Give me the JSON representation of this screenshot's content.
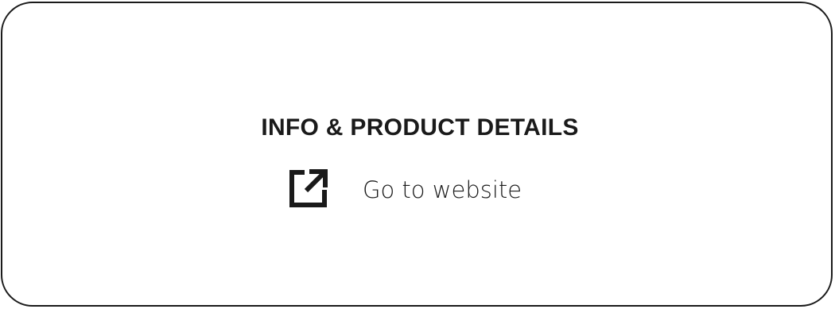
{
  "card": {
    "title": "INFO & PRODUCT DETAILS",
    "link": {
      "icon": "external-link-icon",
      "label": "Go to website"
    }
  },
  "colors": {
    "text": "#1a1a1a",
    "border": "#1a1a1a",
    "background": "#ffffff"
  }
}
